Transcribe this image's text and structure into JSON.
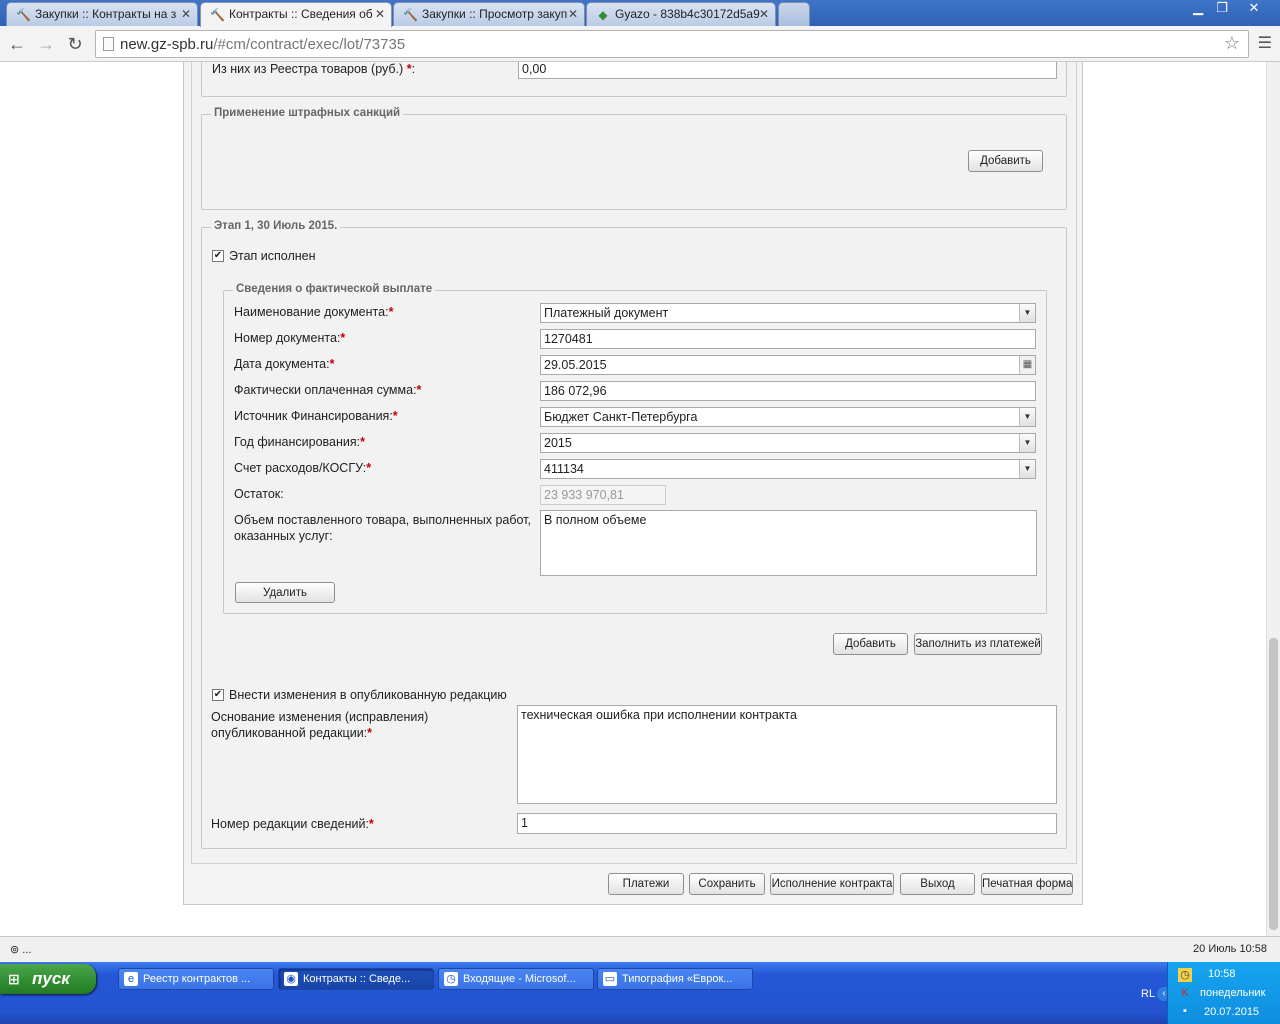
{
  "browser": {
    "tabs": [
      {
        "title": "Закупки :: Контракты на з",
        "icon": "hammer-icon"
      },
      {
        "title": "Контракты :: Сведения об",
        "icon": "hammer-icon"
      },
      {
        "title": "Закупки :: Просмотр закуп",
        "icon": "hammer-icon"
      },
      {
        "title": "Gyazo - 838b4c30172d5a9",
        "icon": "gyazo-icon"
      }
    ],
    "url_host": "new.gz-spb.ru",
    "url_path": "/#cm/contract/exec/lot/73735"
  },
  "form": {
    "reg_goods_label": "Из них из Реестра товаров (руб.)",
    "reg_goods_value": "0,00",
    "penalties_legend": "Применение штрафных санкций",
    "add_label": "Добавить",
    "stage_legend": "Этап 1, 30 Июль 2015.",
    "stage_done_label": "Этап исполнен",
    "payment_legend": "Сведения о фактической выплате",
    "doc_name_label": "Наименование документа:",
    "doc_name_value": "Платежный документ",
    "doc_number_label": "Номер документа:",
    "doc_number_value": "1270481",
    "doc_date_label": "Дата документа:",
    "doc_date_value": "29.05.2015",
    "paid_sum_label": "Фактически оплаченная сумма:",
    "paid_sum_value": "186 072,96",
    "source_label": "Источник Финансирования:",
    "source_value": "Бюджет Санкт-Петербурга",
    "year_label": "Год финансирования:",
    "year_value": "2015",
    "account_label": "Счет расходов/КОСГУ:",
    "account_value": "411134",
    "remainder_label": "Остаток:",
    "remainder_value": "23 933 970,81",
    "volume_label_1": "Объем поставленного товара, выполненных работ,",
    "volume_label_2": "оказанных услуг:",
    "volume_value": "В полном объеме",
    "delete_label": "Удалить",
    "fill_from_payments_label": "Заполнить из платежей",
    "publish_changes_label": "Внести изменения в опубликованную редакцию",
    "change_reason_label_1": "Основание изменения (исправления)",
    "change_reason_label_2": "опубликованной редакции:",
    "change_reason_value": "техническая ошибка при исполнении контракта",
    "revision_label": "Номер редакции сведений:",
    "revision_value": "1",
    "required_mark": "*"
  },
  "actions": {
    "payments": "Платежи",
    "save": "Сохранить",
    "contract_exec": "Исполнение контракта",
    "exit": "Выход",
    "print": "Печатная форма"
  },
  "statusbar": {
    "left": "...",
    "right": "20 Июль 10:58"
  },
  "taskbar": {
    "start": "пуск",
    "buttons": [
      {
        "label": "Реестр контрактов ...",
        "icon": "ie-icon"
      },
      {
        "label": "Контракты :: Сведе...",
        "icon": "chrome-icon"
      },
      {
        "label": "Входящие - Microsof...",
        "icon": "outlook-icon"
      },
      {
        "label": "Типография «Еврок...",
        "icon": "folder-icon"
      }
    ],
    "lang": "RL",
    "time": "10:58",
    "weekday": "понедельник",
    "date": "20.07.2015"
  }
}
